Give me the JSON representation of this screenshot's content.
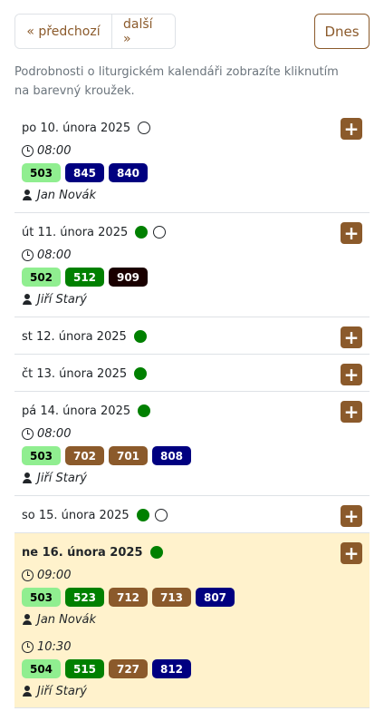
{
  "nav": {
    "prev_label": "« předchozí",
    "next_label": "další »",
    "today_label": "Dnes"
  },
  "note": "Podrobnosti o liturgickém kalendáři zobrazíte kliknutím na barevný kroužek.",
  "colors": {
    "accent": "#8b5a2b",
    "today_bg": "#fff2cc",
    "green": "#008000",
    "light_green": "#90ee90",
    "navy": "#000080"
  },
  "add_icon": "+",
  "days": [
    {
      "date": "po 10. února 2025",
      "circles": [
        "white"
      ],
      "services": [
        {
          "time": "08:00",
          "chips": [
            {
              "num": "503",
              "color": "lightgreen"
            },
            {
              "num": "845",
              "color": "navy"
            },
            {
              "num": "840",
              "color": "navy"
            }
          ],
          "person": "Jan Novák"
        }
      ]
    },
    {
      "date": "út 11. února 2025",
      "circles": [
        "green",
        "white"
      ],
      "services": [
        {
          "time": "08:00",
          "chips": [
            {
              "num": "502",
              "color": "lightgreen"
            },
            {
              "num": "512",
              "color": "green"
            },
            {
              "num": "909",
              "color": "black"
            }
          ],
          "person": "Jiří Starý"
        }
      ]
    },
    {
      "date": "st 12. února 2025",
      "circles": [
        "green"
      ],
      "services": []
    },
    {
      "date": "čt 13. února 2025",
      "circles": [
        "green"
      ],
      "services": []
    },
    {
      "date": "pá 14. února 2025",
      "circles": [
        "green"
      ],
      "services": [
        {
          "time": "08:00",
          "chips": [
            {
              "num": "503",
              "color": "lightgreen"
            },
            {
              "num": "702",
              "color": "brown"
            },
            {
              "num": "701",
              "color": "brown"
            },
            {
              "num": "808",
              "color": "navy"
            }
          ],
          "person": "Jiří Starý"
        }
      ]
    },
    {
      "date": "so 15. února 2025",
      "circles": [
        "green",
        "white"
      ],
      "services": []
    },
    {
      "date": "ne 16. února 2025",
      "circles": [
        "green"
      ],
      "today": true,
      "services": [
        {
          "time": "09:00",
          "chips": [
            {
              "num": "503",
              "color": "lightgreen"
            },
            {
              "num": "523",
              "color": "green"
            },
            {
              "num": "712",
              "color": "brown"
            },
            {
              "num": "713",
              "color": "brown"
            },
            {
              "num": "807",
              "color": "navy"
            }
          ],
          "person": "Jan Novák"
        },
        {
          "time": "10:30",
          "chips": [
            {
              "num": "504",
              "color": "lightgreen"
            },
            {
              "num": "515",
              "color": "green"
            },
            {
              "num": "727",
              "color": "brown"
            },
            {
              "num": "812",
              "color": "navy"
            }
          ],
          "person": "Jiří Starý"
        }
      ]
    }
  ]
}
